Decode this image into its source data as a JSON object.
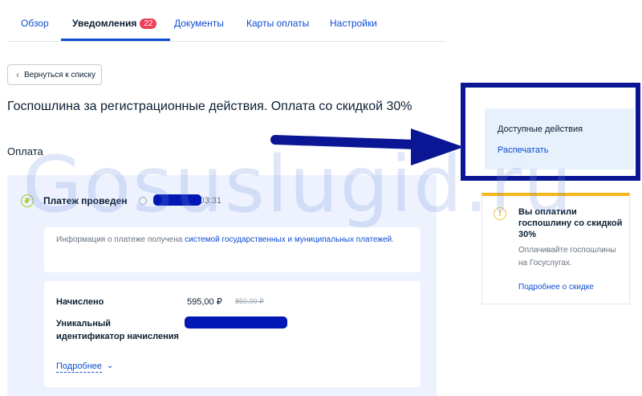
{
  "tabs": [
    {
      "label": "Обзор",
      "active": false
    },
    {
      "label": "Уведомления",
      "active": true,
      "badge": "22"
    },
    {
      "label": "Документы",
      "active": false
    },
    {
      "label": "Карты оплаты",
      "active": false
    },
    {
      "label": "Настройки",
      "active": false
    }
  ],
  "back_button": {
    "label": "Вернуться к списку",
    "icon": "chevron-left-icon"
  },
  "page_title": "Госпошлина за регистрационные действия. Оплата со скидкой 30%",
  "section_label": "Оплата",
  "payment": {
    "status_icon": "ruble-icon",
    "status": "Платеж проведен",
    "time": "03:31",
    "info_text": "Информация о платеже получена ",
    "info_link": "системой государственных и муниципальных платежей",
    "info_end": ".",
    "details": {
      "charged_label": "Начислено",
      "amount": "595,00 ₽",
      "old_amount": "850,00 ₽",
      "uid_label_line1": "Уникальный",
      "uid_label_line2": "идентификатор начисления",
      "more_link": "Подробнее"
    }
  },
  "actions": {
    "title": "Доступные действия",
    "print": "Распечатать"
  },
  "discount": {
    "icon": "warning-icon",
    "title": "Вы оплатили госпошлину со скидкой 30%",
    "text": "Оплачивайте госпошлины на Госуслугах.",
    "link": "Подробнее о скидке"
  },
  "watermark": "Gosuslugid.ru",
  "colors": {
    "accent": "#0d4cd3",
    "badge": "#ee3f58",
    "success": "#a4c31c",
    "warning": "#f5b81a",
    "annotation": "#0a1694"
  }
}
